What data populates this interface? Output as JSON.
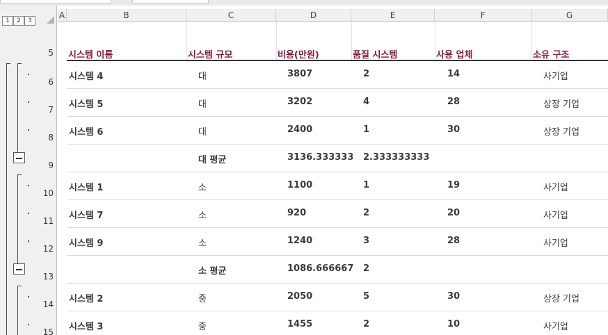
{
  "outline_levels": [
    "1",
    "2",
    "3"
  ],
  "columns": [
    "A",
    "B",
    "C",
    "D",
    "E",
    "F",
    "G"
  ],
  "header_row": {
    "row_number": "5",
    "cells": [
      "시스템 이름",
      "시스템 규모",
      "비용(만원)",
      "품질 시스템",
      "사용 업체",
      "소유 구조"
    ]
  },
  "rows": [
    {
      "row_number": "6",
      "cells": [
        "시스템 4",
        "대",
        "3807",
        "2",
        "14",
        "사기업"
      ],
      "subtotal": false
    },
    {
      "row_number": "7",
      "cells": [
        "시스템 5",
        "대",
        "3202",
        "4",
        "28",
        "상장 기업"
      ],
      "subtotal": false
    },
    {
      "row_number": "8",
      "cells": [
        "시스템 6",
        "대",
        "2400",
        "1",
        "30",
        "상장 기업"
      ],
      "subtotal": false
    },
    {
      "row_number": "9",
      "cells": [
        "",
        "대 평균",
        "3136.333333",
        "2.333333333",
        "",
        ""
      ],
      "subtotal": true
    },
    {
      "row_number": "10",
      "cells": [
        "시스템 1",
        "소",
        "1100",
        "1",
        "19",
        "사기업"
      ],
      "subtotal": false
    },
    {
      "row_number": "11",
      "cells": [
        "시스템 7",
        "소",
        "920",
        "2",
        "20",
        "사기업"
      ],
      "subtotal": false
    },
    {
      "row_number": "12",
      "cells": [
        "시스템 9",
        "소",
        "1240",
        "3",
        "28",
        "사기업"
      ],
      "subtotal": false
    },
    {
      "row_number": "13",
      "cells": [
        "",
        "소 평균",
        "1086.666667",
        "2",
        "",
        ""
      ],
      "subtotal": true
    },
    {
      "row_number": "14",
      "cells": [
        "시스템 2",
        "중",
        "2050",
        "5",
        "30",
        "상장 기업"
      ],
      "subtotal": false
    },
    {
      "row_number": "15",
      "cells": [
        "시스템 3",
        "중",
        "1455",
        "2",
        "10",
        "사기업"
      ],
      "subtotal": false
    }
  ],
  "colors": {
    "header_text": "#8b1a3a",
    "body_text": "#3a3a3a",
    "panel_bg": "#f0f0f0"
  }
}
